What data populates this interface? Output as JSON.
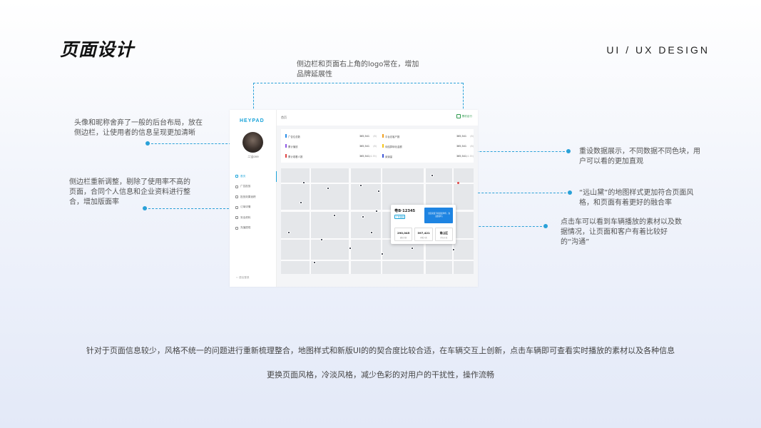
{
  "header": {
    "title": "页面设计",
    "tag": "UI / UX DESIGN"
  },
  "notes": {
    "logo_note": "侧边栏和页面右上角的logo常在，增加\n品牌延展性",
    "avatar_note": "头像和昵称舍弃了一般的后台布局，放在\n侧边栏，让使用者的信息呈现更加清晰",
    "sidebar_note": "侧边栏重新调整，剔除了使用率不高的\n页面，合同个人信息和企业资料进行整\n合，增加版面率",
    "data_note": "重设数据展示，不同数据不同色块，用\n户可以看的更加直观",
    "map_note": "“远山黛”的地图样式更加符合页面风\n格，和页面有着更好的融合率",
    "car_note": "点击车可以看到车辆播放的素材以及数\n据情况，让页面和客户有着比较好\n的“沟通”"
  },
  "footer": {
    "line1": "针对于页面信息较少，风格不统一的问题进行重新梳理整合，地图样式和新版UI的的契合度比较合适，在车辆交互上创新，点击车辆即可查看实时播放的素材以及各种信息",
    "line2": "更换页面风格，冷淡风格，减少色彩的对用户的干扰性，操作流畅"
  },
  "mockup": {
    "logo": "HEYPAD",
    "nickname": "二宝one",
    "menu": [
      {
        "label": "首页",
        "icon": "monitor-icon",
        "active": true
      },
      {
        "label": "广告投放",
        "icon": "megaphone-icon"
      },
      {
        "label": "投放效果追踪",
        "icon": "chart-icon"
      },
      {
        "label": "订单详情",
        "icon": "order-icon"
      },
      {
        "label": "安全资料",
        "icon": "shield-icon"
      },
      {
        "label": "充值提现",
        "icon": "wallet-icon"
      }
    ],
    "exit_label": "退出登录",
    "breadcrumb": "首页",
    "brand_text": "黑豹出行",
    "stats": [
      {
        "label": "广告位总数",
        "value": "365,541",
        "change": "(8)",
        "color": "#2a8ee8"
      },
      {
        "label": "平台总客户数",
        "value": "365,541",
        "change": "(8)",
        "color": "#f0a020"
      },
      {
        "label": "累计播放",
        "value": "365,541",
        "change": "(8)",
        "color": "#8e5ae6"
      },
      {
        "label": "待结算转化金额",
        "value": "365,541",
        "change": "(8)",
        "color": "#f5c518"
      },
      {
        "label": "累计观看人数",
        "value": "365,541",
        "change": "(4.35)",
        "color": "#e04545"
      },
      {
        "label": "阅读量",
        "value": "365,541",
        "change": "(4.35)",
        "color": "#3d56d8"
      }
    ],
    "popup": {
      "plate": "粤B·12345",
      "tag": "广告播放",
      "ad_text": "全民家装节家装嘉年华，欢迎您参与",
      "stats": [
        {
          "num": "290,045",
          "caption": "播放次数"
        },
        {
          "num": "397,421",
          "caption": "观看人数"
        },
        {
          "num": "南山区",
          "caption": "所在区域"
        }
      ]
    }
  }
}
